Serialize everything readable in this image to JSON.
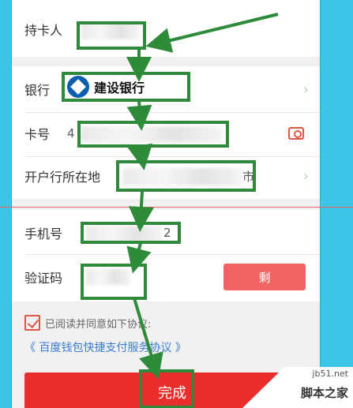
{
  "form": {
    "cardholder_label": "持卡人",
    "bank_label": "银行",
    "bank_name": "建设银行",
    "card_number_label": "卡号",
    "card_number_prefix": "4",
    "branch_label": "开户行所在地",
    "branch_suffix": "市",
    "phone_label": "手机号",
    "phone_suffix": "2",
    "code_label": "验证码",
    "resend_label": "剩",
    "chevron": "›"
  },
  "agreement": {
    "checkbox_text": "已阅读并同意如下协议:",
    "link_text": "《 百度钱包快捷支付服务协议 》"
  },
  "submit_label": "完成",
  "watermark": {
    "site": "jb51.net",
    "brand": "脚本之家"
  },
  "colors": {
    "annotation": "#2e8b3a",
    "primary": "#e92d2d",
    "link": "#3a7bd5"
  }
}
